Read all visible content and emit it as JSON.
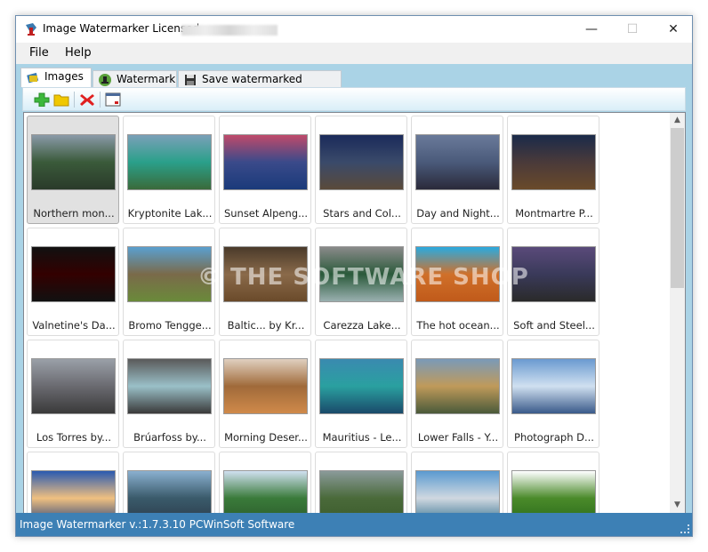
{
  "window": {
    "title": "Image Watermarker Licensed",
    "minimize": "—",
    "maximize": "☐",
    "close": "✕"
  },
  "menu": {
    "file": "File",
    "help": "Help"
  },
  "tabs": [
    {
      "label": "Images"
    },
    {
      "label": "Watermark"
    },
    {
      "label": "Save watermarked images"
    }
  ],
  "watermark_overlay": "© THE SOFTWARE SHOP",
  "images": [
    {
      "label": "Northern mon...",
      "selected": true,
      "colors": [
        "#8a9aa8",
        "#3a5a3a",
        "#2a3a2a"
      ]
    },
    {
      "label": "Kryptonite Lak...",
      "colors": [
        "#7aa0b8",
        "#2aa08a",
        "#3a6a3a"
      ]
    },
    {
      "label": "Sunset Alpeng...",
      "colors": [
        "#c04a6a",
        "#3a4a8a",
        "#1a3a7a"
      ]
    },
    {
      "label": "Stars and Col...",
      "colors": [
        "#1a2a5a",
        "#3a4a6a",
        "#5a4a3a"
      ]
    },
    {
      "label": "Day and Night...",
      "colors": [
        "#6a7a9a",
        "#4a5a7a",
        "#2a2a3a"
      ]
    },
    {
      "label": "Montmartre P...",
      "colors": [
        "#1a2a4a",
        "#4a3a3a",
        "#6a4a2a"
      ]
    },
    {
      "label": "Valnetine's Da...",
      "colors": [
        "#111",
        "#300",
        "#111"
      ]
    },
    {
      "label": "Bromo Tengge...",
      "colors": [
        "#5aa0d0",
        "#7a6a4a",
        "#6a8a3a"
      ]
    },
    {
      "label": "Baltic... by Kr...",
      "colors": [
        "#4a3a2a",
        "#8a6a4a",
        "#6a4a2a"
      ]
    },
    {
      "label": "Carezza Lake...",
      "colors": [
        "#8a8a8a",
        "#2a5a3a",
        "#9ab0b0"
      ]
    },
    {
      "label": "The hot ocean...",
      "colors": [
        "#2aaae0",
        "#d0702a",
        "#c05a1a"
      ]
    },
    {
      "label": "Soft and Steel...",
      "colors": [
        "#5a4a7a",
        "#3a3a5a",
        "#2a2a2a"
      ]
    },
    {
      "label": "Los Torres by...",
      "colors": [
        "#9aa0a8",
        "#6a6a70",
        "#3a3a3a"
      ]
    },
    {
      "label": "Brúarfoss by...",
      "colors": [
        "#5a5a5a",
        "#9ac0c8",
        "#3a3a3a"
      ]
    },
    {
      "label": "Morning Deser...",
      "colors": [
        "#e0d0c0",
        "#a06a3a",
        "#d08a4a"
      ]
    },
    {
      "label": "Mauritius - Le...",
      "colors": [
        "#3a8ab0",
        "#2aa0a0",
        "#1a4a6a"
      ]
    },
    {
      "label": "Lower Falls - Y...",
      "colors": [
        "#7a9ab8",
        "#c09a5a",
        "#4a5a3a"
      ]
    },
    {
      "label": "Photograph D...",
      "colors": [
        "#6a9ad0",
        "#d0e0f0",
        "#3a5a8a"
      ]
    },
    {
      "label": "",
      "colors": [
        "#2a5ab0",
        "#f0c080",
        "#1a3a7a"
      ]
    },
    {
      "label": "",
      "colors": [
        "#8ab0d0",
        "#3a5a6a",
        "#2a3a4a"
      ]
    },
    {
      "label": "",
      "colors": [
        "#d0e0f0",
        "#3a7a3a",
        "#2a5a2a"
      ]
    },
    {
      "label": "",
      "colors": [
        "#8a9a9a",
        "#4a6a3a",
        "#3a5a2a"
      ]
    },
    {
      "label": "",
      "colors": [
        "#5a9ad0",
        "#d0d8e0",
        "#2a6a8a"
      ]
    },
    {
      "label": "",
      "colors": [
        "#ffffff",
        "#4a8a2a",
        "#2a6a1a"
      ]
    }
  ],
  "status": "Image Watermarker v.:1.7.3.10 PCWinSoft Software"
}
